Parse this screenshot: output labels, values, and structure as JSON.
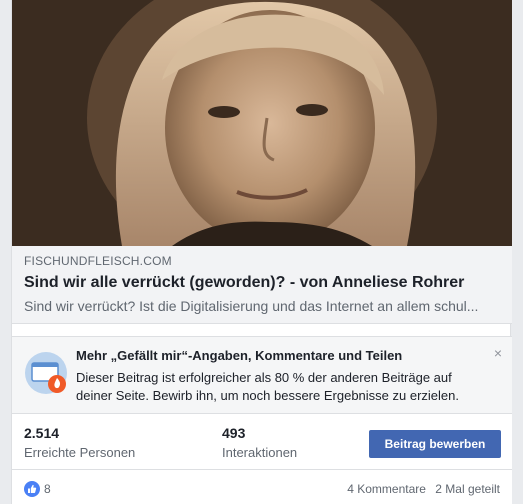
{
  "link_preview": {
    "domain": "FISCHUNDFLEISCH.COM",
    "title": "Sind wir alle verrückt (geworden)? - von Anneliese Rohrer",
    "description": "Sind wir verrückt? Ist die Digitalisierung und das Internet an allem schul..."
  },
  "promo": {
    "icon": "boost-post-icon",
    "title": "Mehr „Gefällt mir“-Angaben, Kommentare und Teilen",
    "body": "Dieser Beitrag ist erfolgreicher als 80 % der anderen Beiträge auf deiner Seite. Bewirb ihn, um noch bessere Ergebnisse zu erzielen.",
    "close": "×"
  },
  "stats": {
    "reach_value": "2.514",
    "reach_label": "Erreichte Personen",
    "engagement_value": "493",
    "engagement_label": "Interaktionen",
    "boost_button": "Beitrag bewerben"
  },
  "footer": {
    "like_icon": "thumbs-up-icon",
    "like_count": "8",
    "comments": "4 Kommentare",
    "shares": "2 Mal geteilt"
  },
  "colors": {
    "accent": "#4267b2",
    "background": "#e9ebee",
    "muted_text": "#606770"
  }
}
